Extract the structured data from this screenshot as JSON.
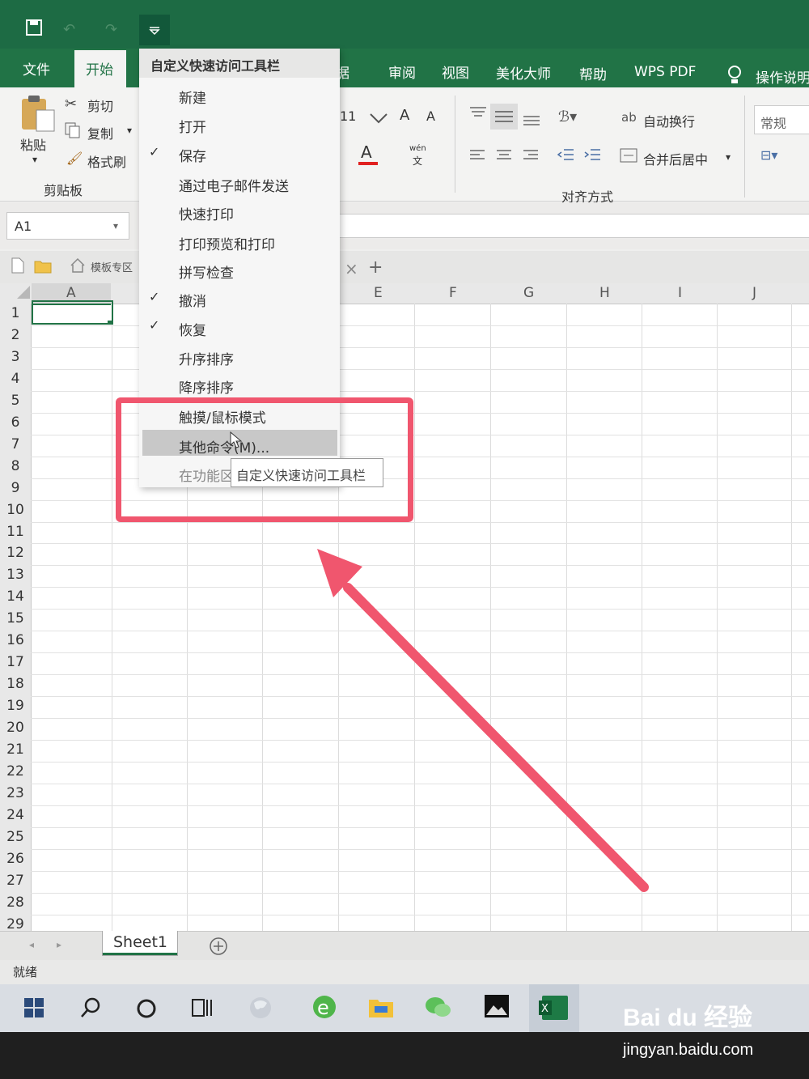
{
  "tabs": {
    "file": "文件",
    "home": "开始",
    "data": "数据",
    "review": "审阅",
    "view": "视图",
    "beautify": "美化大师",
    "help": "帮助",
    "wps_pdf": "WPS PDF",
    "tell_me": "操作说明"
  },
  "clipboard": {
    "paste": "粘贴",
    "cut": "剪切",
    "copy": "复制",
    "format_painter": "格式刷",
    "group": "剪贴板"
  },
  "font": {
    "size": "11",
    "grow": "A",
    "shrink": "A",
    "color": "A",
    "phonetic_top": "wén",
    "phonetic_bottom": "文"
  },
  "alignment": {
    "wrap_text": "自动换行",
    "merge_center": "合并后居中",
    "group": "对齐方式"
  },
  "number": {
    "format": "常规"
  },
  "name_box": "A1",
  "file_bar": {
    "templates": "模板专区",
    "add_tab": "+",
    "close_tab": "×"
  },
  "columns": [
    "A",
    "E",
    "F",
    "G",
    "H",
    "I",
    "J"
  ],
  "rows": [
    "1",
    "2",
    "3",
    "4",
    "5",
    "6",
    "7",
    "8",
    "9",
    "10",
    "11",
    "12",
    "13",
    "14",
    "15",
    "16",
    "17",
    "18",
    "19",
    "20",
    "21",
    "22",
    "23",
    "24",
    "25",
    "26",
    "27",
    "28",
    "29"
  ],
  "menu": {
    "title": "自定义快速访问工具栏",
    "items": [
      {
        "label": "新建",
        "checked": false
      },
      {
        "label": "打开",
        "checked": false
      },
      {
        "label": "保存",
        "checked": true
      },
      {
        "label": "通过电子邮件发送",
        "checked": false
      },
      {
        "label": "快速打印",
        "checked": false
      },
      {
        "label": "打印预览和打印",
        "checked": false
      },
      {
        "label": "拼写检查",
        "checked": false
      },
      {
        "label": "撤消",
        "checked": true
      },
      {
        "label": "恢复",
        "checked": true
      },
      {
        "label": "升序排序",
        "checked": false
      },
      {
        "label": "降序排序",
        "checked": false
      },
      {
        "label": "触摸/鼠标模式",
        "checked": false
      },
      {
        "label": "其他命令(M)...",
        "checked": false
      },
      {
        "label": "在功能区",
        "checked": false
      }
    ],
    "tooltip": "自定义快速访问工具栏"
  },
  "sheet_tab": "Sheet1",
  "status": "就绪",
  "watermark": {
    "brand": "Bai du 经验",
    "url": "jingyan.baidu.com"
  },
  "colors": {
    "excel_green": "#217346",
    "highlight": "#f0566e"
  }
}
